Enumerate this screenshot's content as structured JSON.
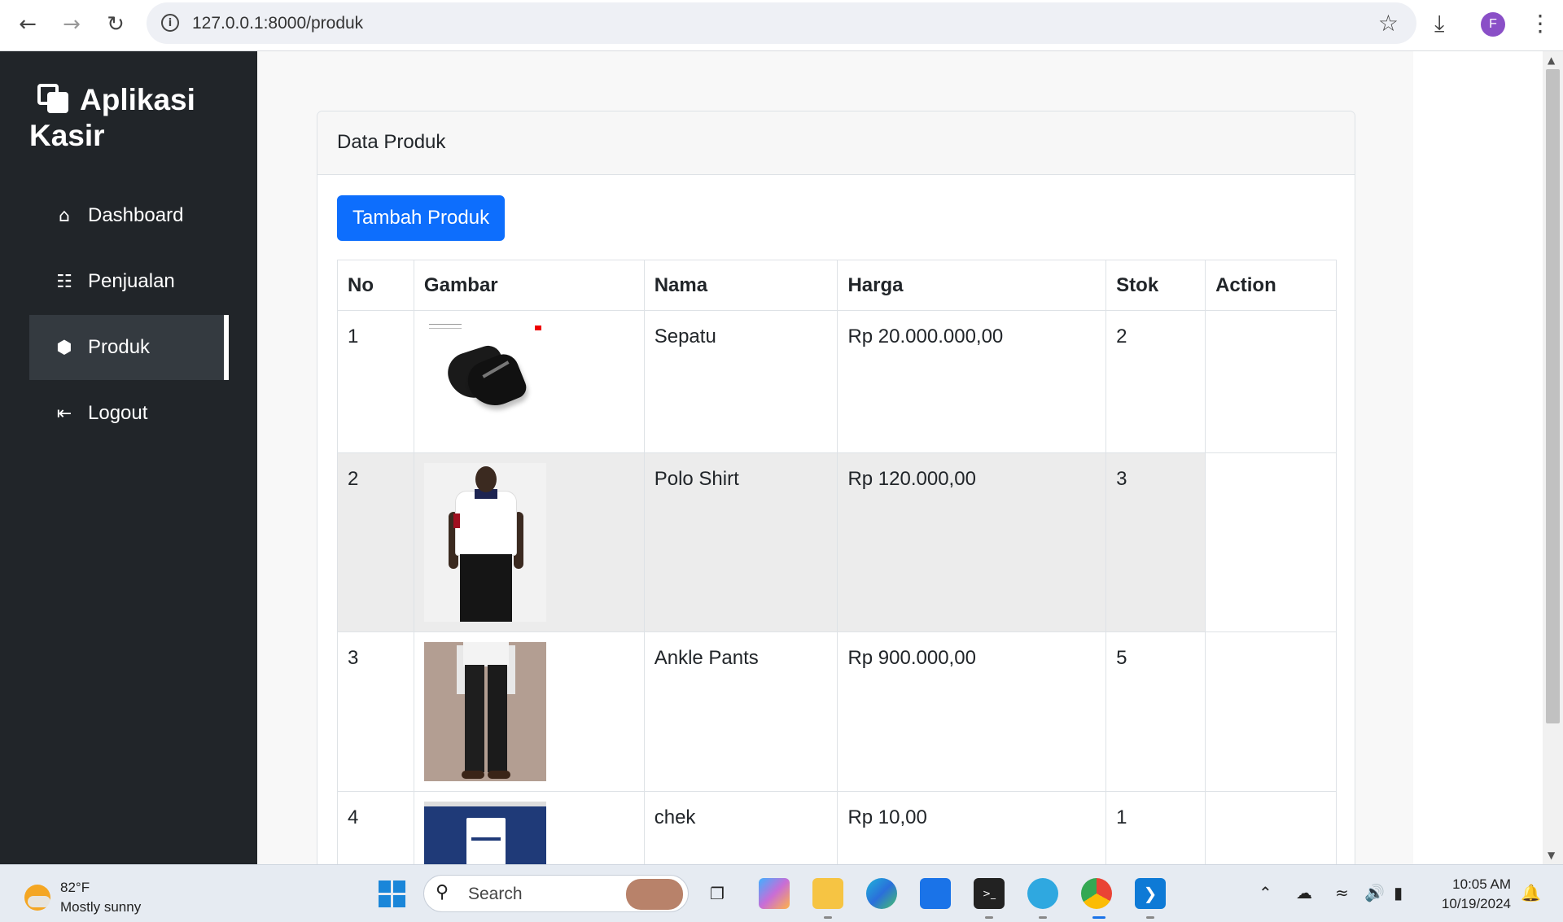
{
  "browser": {
    "url": "127.0.0.1:8000/produk",
    "profile_initial": "F",
    "icons": [
      "back-icon",
      "forward-icon",
      "reload-icon",
      "info-icon",
      "star-icon",
      "download-icon",
      "kebab-menu-icon"
    ]
  },
  "sidebar": {
    "brand": "Aplikasi Kasir",
    "items": [
      {
        "label": "Dashboard",
        "icon": "home-icon"
      },
      {
        "label": "Penjualan",
        "icon": "cart-icon"
      },
      {
        "label": "Produk",
        "icon": "box-icon",
        "active": true
      },
      {
        "label": "Logout",
        "icon": "logout-icon"
      }
    ]
  },
  "card": {
    "title": "Data Produk",
    "add_button": "Tambah Produk",
    "columns": [
      "No",
      "Gambar",
      "Nama",
      "Harga",
      "Stok",
      "Action"
    ],
    "rows": [
      {
        "no": "1",
        "image": "shoe-image",
        "nama": "Sepatu",
        "harga": "Rp 20.000.000,00",
        "stok": "2",
        "action": ""
      },
      {
        "no": "2",
        "image": "polo-shirt-image",
        "nama": "Polo Shirt",
        "harga": "Rp 120.000,00",
        "stok": "3",
        "action": ""
      },
      {
        "no": "3",
        "image": "ankle-pants-image",
        "nama": "Ankle Pants",
        "harga": "Rp 900.000,00",
        "stok": "5",
        "action": ""
      },
      {
        "no": "4",
        "image": "screenshot-image",
        "nama": "chek",
        "harga": "Rp 10,00",
        "stok": "1",
        "action": ""
      }
    ]
  },
  "colors": {
    "sidebar_bg": "#212529",
    "primary": "#0d6efd",
    "active_item_bg": "#343a40"
  },
  "taskbar": {
    "weather_temp": "82°F",
    "weather_desc": "Mostly sunny",
    "search_placeholder": "Search",
    "time": "10:05 AM",
    "date": "10/19/2024",
    "profile_badge": "F"
  }
}
